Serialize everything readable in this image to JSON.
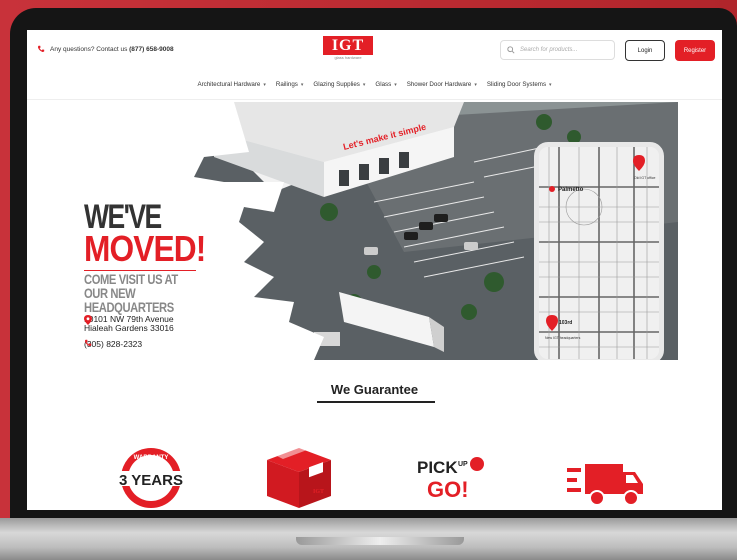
{
  "header": {
    "contact_text": "Any questions? Contact us",
    "contact_phone": "(877) 658-9008",
    "logo_text": "IGT",
    "logo_sub": "glass hardware",
    "search_placeholder": "Search for products...",
    "login_label": "Login",
    "register_label": "Register"
  },
  "nav": {
    "items": [
      {
        "label": "Architectural Hardware"
      },
      {
        "label": "Railings"
      },
      {
        "label": "Glazing Supplies"
      },
      {
        "label": "Glass"
      },
      {
        "label": "Shower Door Hardware"
      },
      {
        "label": "Sliding Door Systems"
      }
    ]
  },
  "hero": {
    "line1": "WE'VE",
    "line2": "MOVED!",
    "line3": "COME VISIT US AT OUR NEW HEADQUARTERS",
    "address1": "10101 NW 79th Avenue",
    "address2": "Hialeah Gardens 33016",
    "phone": "(305) 828-2323",
    "building_sign": "Let's make it simple",
    "map_label_palmetto": "Palmetto",
    "map_label_old": "Old IGT office",
    "map_label_new": "New IGT headquarters",
    "map_label_103": "103rd"
  },
  "guarantee": {
    "title": "We Guarantee",
    "badge1_text": "3 YEARS",
    "badge1_arc": "WARRANTY",
    "badge3_text1": "PICK",
    "badge3_text2": "UP",
    "badge3_text3": "GO!",
    "box_logo": "IGT"
  },
  "colors": {
    "brand_red": "#e31f26",
    "background_red": "#b92a2f"
  }
}
